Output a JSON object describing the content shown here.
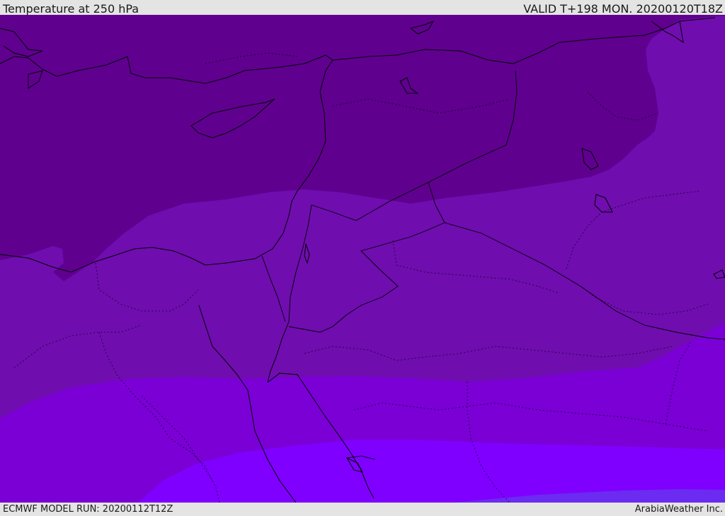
{
  "header": {
    "title": "Temperature at 250 hPa",
    "valid": "VALID T+198 MON. 20200120T18Z"
  },
  "footer": {
    "model_run": "ECMWF MODEL RUN: 20200112T12Z",
    "credit": "ArabiaWeather Inc."
  },
  "colors": {
    "band_1": "#5f008f",
    "band_2": "#6f0daf",
    "band_3": "#7a00d6",
    "band_4": "#7f00ff",
    "band_5": "#6b2bf0",
    "outline": "#000000"
  }
}
